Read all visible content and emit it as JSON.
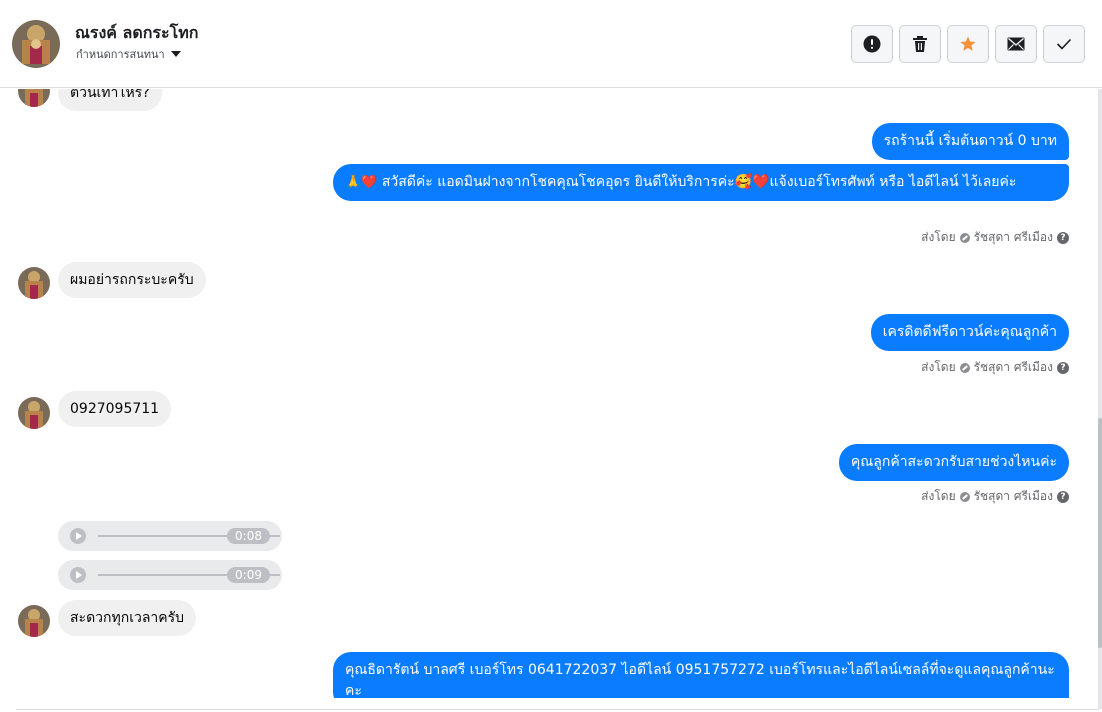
{
  "header": {
    "contact_name": "ณรงค์ ลดกระโทก",
    "conversation_settings": "กำหนดการสนทนา",
    "actions": [
      {
        "name": "report-button",
        "icon": "exclamation-icon"
      },
      {
        "name": "delete-button",
        "icon": "trash-icon"
      },
      {
        "name": "star-button",
        "icon": "star-icon",
        "color": "#f7923b"
      },
      {
        "name": "mark-unread-button",
        "icon": "envelope-icon"
      },
      {
        "name": "mark-done-button",
        "icon": "check-icon"
      }
    ]
  },
  "thread": {
    "messages": [
      {
        "direction": "in",
        "text": "ตัวนี้เท่าไหร่?"
      },
      {
        "direction": "out",
        "text": "รถร้านนี้ เริ่มต้นดาวน์ 0 บาท"
      },
      {
        "direction": "out",
        "emoji_lead": "🙏❤️",
        "text": "สวัสดีค่ะ แอดมินฝางจากโชคคุณโชคอุดร ยินดีให้บริการค่ะ🥰❤️แจ้งเบอร์โทรศัพท์ หรือ ไอดีไลน์  ไว้เลยค่ะ"
      },
      {
        "direction": "in",
        "text": "ผมอย่ารถกระบะครับ"
      },
      {
        "direction": "out",
        "text": "เครดิตดีฟรีดาวน์ค่ะคุณลูกค้า"
      },
      {
        "direction": "in",
        "text": "0927095711"
      },
      {
        "direction": "out",
        "text": "คุณลูกค้าสะดวกรับสายช่วงไหนค่ะ"
      },
      {
        "direction": "in",
        "type": "audio",
        "duration": "0:08"
      },
      {
        "direction": "in",
        "type": "audio",
        "duration": "0:09"
      },
      {
        "direction": "in",
        "text": "สะดวกทุกเวลาครับ"
      },
      {
        "direction": "out",
        "text": "คุณธิดารัตน์ บาลศรี เบอร์โทร 0641722037  ไอดีไลน์ 0951757272   เบอร์โทรและไอดีไลน์เซลล์ที่จะดูแลคุณลูกค้านะคะ"
      }
    ],
    "sent_by": {
      "prefix": "ส่งโดย",
      "agent": "รัชสุดา ศรีเมือง",
      "help": "?"
    }
  },
  "colors": {
    "outgoing_bubble": "#0a7cff",
    "incoming_bubble": "#f0f0f0",
    "star": "#f7923b"
  }
}
